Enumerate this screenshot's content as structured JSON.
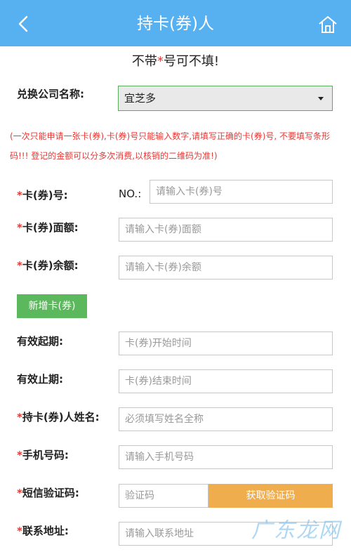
{
  "header": {
    "title": "持卡(券)人"
  },
  "notice": {
    "prefix": "不带",
    "star": "*",
    "suffix": "号可不填!"
  },
  "company": {
    "label": "兑换公司名称:",
    "selected": "宜芝多"
  },
  "warning": {
    "line1": "(一次只能申请一张卡(券),卡(券)号只能输入数字,请填写正确的卡(券)号, 不要填写条形",
    "line2": "码!!! 登记的金额可以分多次消费,以核销的二维码为准!)"
  },
  "card_no": {
    "required": "*",
    "label": "卡(券)号:",
    "prefix": "NO.:",
    "placeholder": "请输入卡(券)号"
  },
  "face_value": {
    "required": "*",
    "label": "卡(券)面额:",
    "placeholder": "请输入卡(券)面额"
  },
  "balance": {
    "required": "*",
    "label": "卡(券)余额:",
    "placeholder": "请输入卡(券)余额"
  },
  "add_button": {
    "label": "新增卡(券)"
  },
  "valid_from": {
    "label": "有效起期:",
    "placeholder": "卡(券)开始时间"
  },
  "valid_to": {
    "label": "有效止期:",
    "placeholder": "卡(券)结束时间"
  },
  "holder_name": {
    "required": "*",
    "label": "持卡(券)人姓名:",
    "placeholder": "必须填写姓名全称"
  },
  "phone": {
    "required": "*",
    "label": "手机号码:",
    "placeholder": "请输入手机号码"
  },
  "sms_code": {
    "required": "*",
    "label": "短信验证码:",
    "placeholder": "验证码",
    "button": "获取验证码"
  },
  "address": {
    "required": "*",
    "label": "联系地址:",
    "placeholder": "请输入联系地址"
  },
  "watermark": {
    "text": "广东龙网"
  },
  "colors": {
    "header": "#57b0f0",
    "accent_red": "#e53935",
    "button_green": "#5cb85c",
    "button_orange": "#f0ad4e"
  },
  "icons": {
    "back": "chevron-left-icon",
    "home": "home-icon"
  }
}
